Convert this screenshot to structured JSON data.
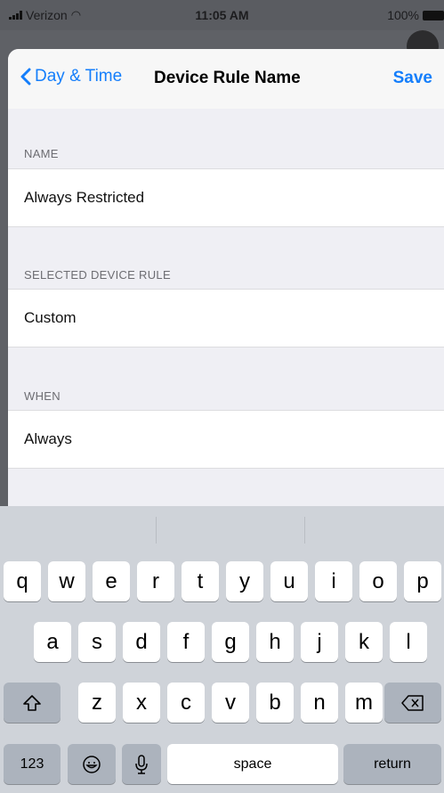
{
  "status": {
    "carrier": "Verizon",
    "time": "11:05 AM",
    "battery": "100%"
  },
  "nav": {
    "back": "Day & Time",
    "title": "Device Rule Name",
    "save": "Save"
  },
  "sections": [
    {
      "header": "NAME",
      "value": "Always Restricted"
    },
    {
      "header": "SELECTED DEVICE RULE",
      "value": "Custom"
    },
    {
      "header": "WHEN",
      "value": "Always"
    }
  ],
  "keyboard": {
    "row1": [
      "q",
      "w",
      "e",
      "r",
      "t",
      "y",
      "u",
      "i",
      "o",
      "p"
    ],
    "row2": [
      "a",
      "s",
      "d",
      "f",
      "g",
      "h",
      "j",
      "k",
      "l"
    ],
    "row3": [
      "z",
      "x",
      "c",
      "v",
      "b",
      "n",
      "m"
    ],
    "numbers": "123",
    "space": "space",
    "return": "return"
  },
  "colors": {
    "accent": "#147efb"
  }
}
